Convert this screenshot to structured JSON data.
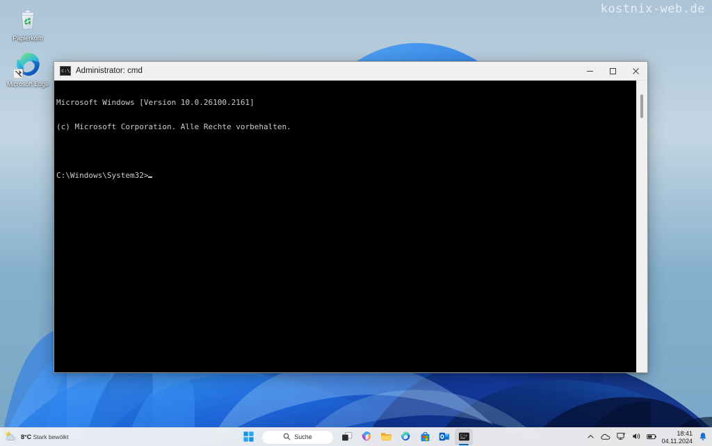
{
  "desktop": {
    "watermark": "kostnix-web.de",
    "icons": [
      {
        "id": "recycle-bin",
        "label": "Papierkorb",
        "icon": "recycle-bin-icon"
      },
      {
        "id": "microsoft-edge",
        "label": "Microsoft Edge",
        "icon": "edge-icon"
      }
    ]
  },
  "window": {
    "title": "Administrator: cmd",
    "icon": "cmd-icon",
    "controls": {
      "minimize": "Minimieren",
      "maximize": "Maximieren",
      "close": "Schließen"
    },
    "console": {
      "lines": [
        "Microsoft Windows [Version 10.0.26100.2161]",
        "(c) Microsoft Corporation. Alle Rechte vorbehalten.",
        "",
        "C:\\Windows\\System32>"
      ],
      "prompt": "C:\\Windows\\System32>",
      "background": "#000000",
      "foreground": "#cccccc"
    }
  },
  "taskbar": {
    "weather": {
      "temperature": "8°C",
      "condition": "Stark bewölkt",
      "icon": "sun-behind-cloud-icon"
    },
    "start": {
      "label": "Start",
      "icon": "windows-logo-icon"
    },
    "search": {
      "label": "Suche",
      "icon": "search-icon"
    },
    "apps": [
      {
        "id": "task-view",
        "label": "Taskansicht",
        "icon": "task-view-icon",
        "active": false
      },
      {
        "id": "copilot",
        "label": "Copilot",
        "icon": "copilot-icon",
        "active": false
      },
      {
        "id": "file-explorer",
        "label": "Datei-Explorer",
        "icon": "folder-icon",
        "active": false
      },
      {
        "id": "edge",
        "label": "Microsoft Edge",
        "icon": "edge-icon",
        "active": false
      },
      {
        "id": "microsoft-store",
        "label": "Microsoft Store",
        "icon": "store-bag-icon",
        "active": false
      },
      {
        "id": "outlook",
        "label": "Outlook",
        "icon": "outlook-icon",
        "active": false
      },
      {
        "id": "command-prompt",
        "label": "Administrator: cmd",
        "icon": "cmd-icon",
        "active": true
      }
    ],
    "tray": {
      "show_hidden": "Ausgeblendete Symbole einblenden",
      "onedrive": "OneDrive",
      "network": "Netzwerk",
      "volume": "Lautstärke",
      "battery": "Akku",
      "notifications": "Benachrichtigungen",
      "time": "18:41",
      "date": "04.11.2024"
    }
  },
  "colors": {
    "accent": "#0067c0",
    "taskbar_bg": "#f3f3f3",
    "titlebar_bg": "#f0f0f0",
    "console_bg": "#000000",
    "console_fg": "#cccccc"
  }
}
